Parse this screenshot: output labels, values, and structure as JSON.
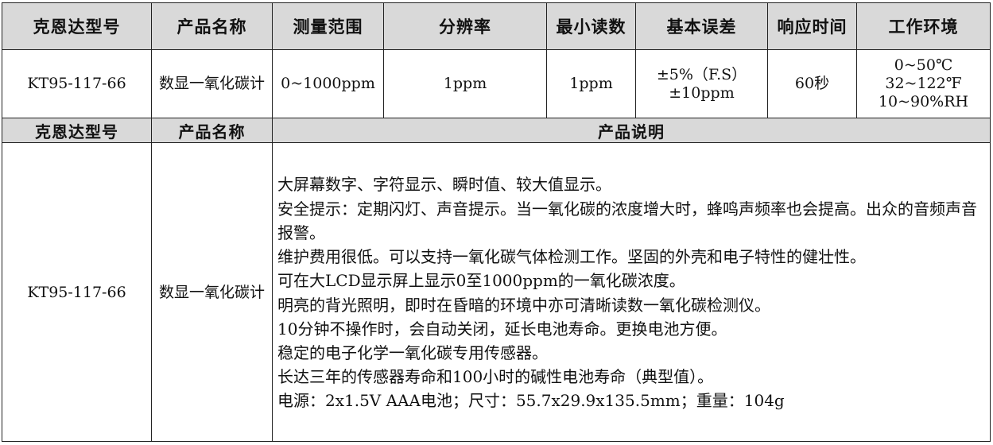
{
  "header": {
    "model": "克恩达型号",
    "name": "产品名称",
    "range": "测量范围",
    "resolution": "分辨率",
    "min_reading": "最小读数",
    "basic_error": "基本误差",
    "response_time": "响应时间",
    "environment": "工作环境"
  },
  "spec_row": {
    "model": "KT95-117-66",
    "name": "数显一氧化碳计",
    "range": "0~1000ppm",
    "resolution": "1ppm",
    "min_reading": "1ppm",
    "basic_error": [
      "±5%（F.S）",
      "±10ppm"
    ],
    "response_time": "60秒",
    "environment": [
      "0~50℃",
      "32~122℉",
      "10~90%RH"
    ]
  },
  "header2": {
    "model": "克恩达型号",
    "name": "产品名称",
    "description": "产品说明"
  },
  "desc_row": {
    "model": "KT95-117-66",
    "name": "数显一氧化碳计",
    "lines": [
      "大屏幕数字、字符显示、瞬时值、较大值显示。",
      "安全提示：定期闪灯、声音提示。当一氧化碳的浓度增大时，蜂鸣声频率也会提高。出众的音频声音报警。",
      "维护费用很低。可以支持一氧化碳气体检测工作。坚固的外壳和电子特性的健壮性。",
      "可在大LCD显示屏上显示0至1000ppm的一氧化碳浓度。",
      "明亮的背光照明，即时在昏暗的环境中亦可清晰读数一氧化碳检测仪。",
      "10分钟不操作时，会自动关闭，延长电池寿命。更换电池方便。",
      "稳定的电子化学一氧化碳专用传感器。",
      "长达三年的传感器寿命和100小时的碱性电池寿命（典型值）。",
      "电源：2x1.5V AAA电池；尺寸：55.7x29.9x135.5mm；重量：104g"
    ]
  }
}
